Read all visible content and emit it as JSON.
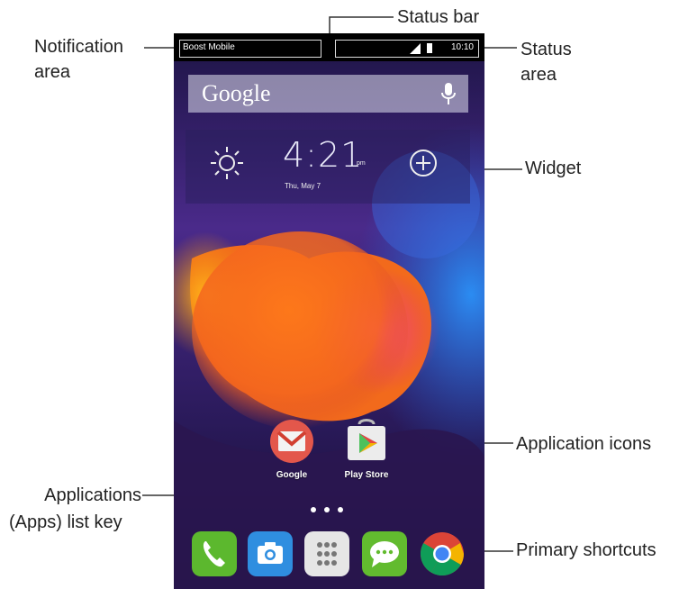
{
  "callouts": {
    "status_bar": "Status bar",
    "notification_area_line1": "Notification",
    "notification_area_line2": "area",
    "status_area_line1": "Status",
    "status_area_line2": "area",
    "widget": "Widget",
    "application_icons": "Application icons",
    "apps_key_line1": "Applications",
    "apps_key_line2": "(Apps) list key",
    "primary_shortcuts": "Primary shortcuts"
  },
  "phone": {
    "carrier": "Boost Mobile",
    "status_time": "10:10",
    "search": {
      "label": "Google",
      "icon": "microphone-icon"
    },
    "clock_widget": {
      "time": "4:21",
      "ampm": "pm",
      "date": "Thu, May 7",
      "weather_icon": "sun-icon",
      "add_icon": "plus-circle-icon"
    },
    "apps": [
      {
        "label": "Google",
        "icon": "gmail-icon"
      },
      {
        "label": "Play Store",
        "icon": "play-store-icon"
      }
    ],
    "dock": [
      {
        "icon": "phone-icon",
        "color": "#5cb82e"
      },
      {
        "icon": "camera-icon",
        "color": "#2f8ee0"
      },
      {
        "icon": "apps-grid-icon",
        "color": "#e6e6e6"
      },
      {
        "icon": "messaging-icon",
        "color": "#62bb2f"
      },
      {
        "icon": "chrome-icon",
        "color": "#db4437"
      }
    ]
  }
}
